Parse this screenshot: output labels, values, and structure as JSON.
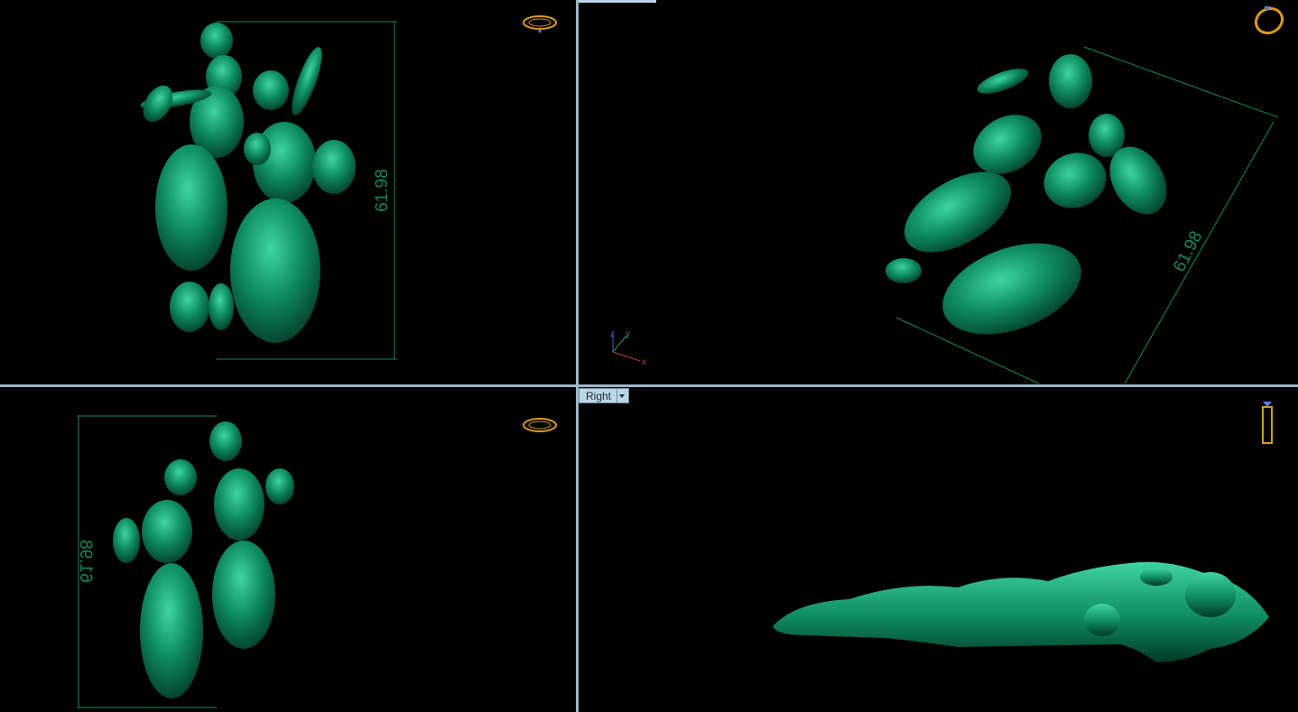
{
  "viewports": {
    "top_left": {
      "dimension": "61.98"
    },
    "top_right": {
      "dimension": "61.98",
      "axes": {
        "x": "x",
        "y": "y",
        "z": "z"
      }
    },
    "bottom_left": {
      "dimension": "61.98"
    },
    "bottom_right": {
      "label": "Right"
    }
  },
  "icons": {
    "top_left": "ring-view-icon",
    "top_right": "ring-perspective-icon",
    "bottom_left": "ring-view-icon",
    "bottom_right": "ring-side-icon"
  },
  "colors": {
    "background": "#000000",
    "model": "#0b7a57",
    "model_highlight": "#3fd4a0",
    "dimension_line": "#0f8a62",
    "icon": "#d99a1e",
    "divider": "#9cb6c8"
  }
}
